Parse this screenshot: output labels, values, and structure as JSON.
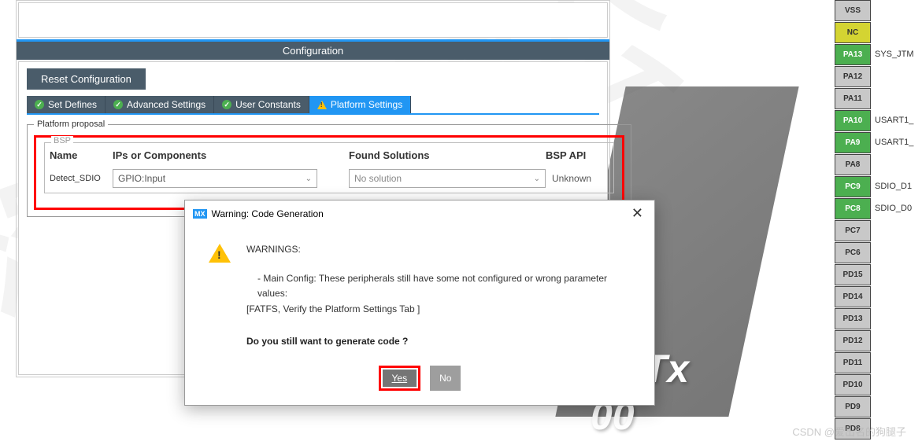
{
  "config_header": "Configuration",
  "reset_button": "Reset Configuration",
  "tabs": [
    {
      "label": "Set Defines",
      "icon": "check"
    },
    {
      "label": "Advanced Settings",
      "icon": "check"
    },
    {
      "label": "User Constants",
      "icon": "check"
    },
    {
      "label": "Platform Settings",
      "icon": "warn",
      "active": true
    }
  ],
  "platform_proposal_legend": "Platform proposal",
  "bsp_legend": "BSP",
  "bsp_headers": {
    "name": "Name",
    "ips": "IPs or Components",
    "found": "Found Solutions",
    "api": "BSP API"
  },
  "bsp_row": {
    "name": "Detect_SDIO",
    "ips_value": "GPIO:Input",
    "found_value": "No solution",
    "api_value": "Unknown"
  },
  "dialog": {
    "mx_badge": "MX",
    "title": "Warning: Code Generation",
    "heading": "WARNINGS:",
    "line1": "- Main Config: These peripherals still have some not configured or wrong parameter values:",
    "line2": "[FATFS, Verify the Platform Settings Tab ]",
    "question": "Do you still want to generate code ?",
    "yes": "Yes",
    "no": "No"
  },
  "chip_text1": "VETx",
  "chip_text2": "00",
  "pins": [
    {
      "name": "VSS",
      "cls": "grey",
      "label": ""
    },
    {
      "name": "NC",
      "cls": "yellow",
      "label": ""
    },
    {
      "name": "PA13",
      "cls": "green",
      "label": "SYS_JTM"
    },
    {
      "name": "PA12",
      "cls": "grey",
      "label": ""
    },
    {
      "name": "PA11",
      "cls": "grey",
      "label": ""
    },
    {
      "name": "PA10",
      "cls": "green",
      "label": "USART1_"
    },
    {
      "name": "PA9",
      "cls": "green",
      "label": "USART1_"
    },
    {
      "name": "PA8",
      "cls": "grey",
      "label": ""
    },
    {
      "name": "PC9",
      "cls": "green",
      "label": "SDIO_D1"
    },
    {
      "name": "PC8",
      "cls": "green",
      "label": "SDIO_D0"
    },
    {
      "name": "PC7",
      "cls": "grey",
      "label": ""
    },
    {
      "name": "PC6",
      "cls": "grey",
      "label": ""
    },
    {
      "name": "PD15",
      "cls": "grey",
      "label": ""
    },
    {
      "name": "PD14",
      "cls": "grey",
      "label": ""
    },
    {
      "name": "PD13",
      "cls": "grey",
      "label": ""
    },
    {
      "name": "PD12",
      "cls": "grey",
      "label": ""
    },
    {
      "name": "PD11",
      "cls": "grey",
      "label": ""
    },
    {
      "name": "PD10",
      "cls": "grey",
      "label": ""
    },
    {
      "name": "PD9",
      "cls": "grey",
      "label": ""
    },
    {
      "name": "PD8",
      "cls": "grey",
      "label": ""
    }
  ],
  "csdn_watermark": "CSDN @爱出名的狗腿子"
}
